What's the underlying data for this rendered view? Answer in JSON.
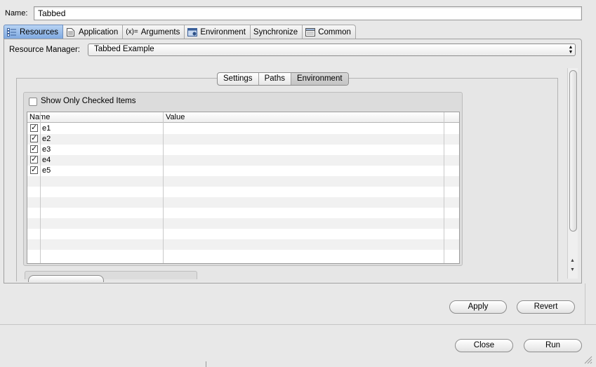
{
  "name_row": {
    "label": "Name:",
    "value": "Tabbed"
  },
  "tabs": [
    {
      "label": "Resources",
      "icon": "resources-icon",
      "active": true
    },
    {
      "label": "Application",
      "icon": "application-icon",
      "active": false
    },
    {
      "label": "Arguments",
      "icon": "arguments-icon",
      "icon_glyph": "(x)=",
      "active": false
    },
    {
      "label": "Environment",
      "icon": "environment-icon",
      "active": false
    },
    {
      "label": "Synchronize",
      "icon": "",
      "active": false
    },
    {
      "label": "Common",
      "icon": "common-icon",
      "active": false
    }
  ],
  "resource_manager": {
    "label": "Resource Manager:",
    "value": "Tabbed Example"
  },
  "segments": [
    {
      "label": "Settings",
      "active": false
    },
    {
      "label": "Paths",
      "active": false
    },
    {
      "label": "Environment",
      "active": true
    }
  ],
  "show_only_checked": {
    "label": "Show Only Checked Items",
    "checked": false
  },
  "table": {
    "headers": [
      "Name",
      "Value"
    ],
    "rows": [
      {
        "name": "e1",
        "value": "",
        "checked": true
      },
      {
        "name": "e2",
        "value": "",
        "checked": true
      },
      {
        "name": "e3",
        "value": "",
        "checked": true
      },
      {
        "name": "e4",
        "value": "",
        "checked": true
      },
      {
        "name": "e5",
        "value": "",
        "checked": true
      }
    ]
  },
  "buttons": {
    "apply": "Apply",
    "revert": "Revert",
    "close": "Close",
    "run": "Run"
  },
  "colors": {
    "active_tab": "#9fc1ec",
    "background": "#e8e8e8"
  }
}
